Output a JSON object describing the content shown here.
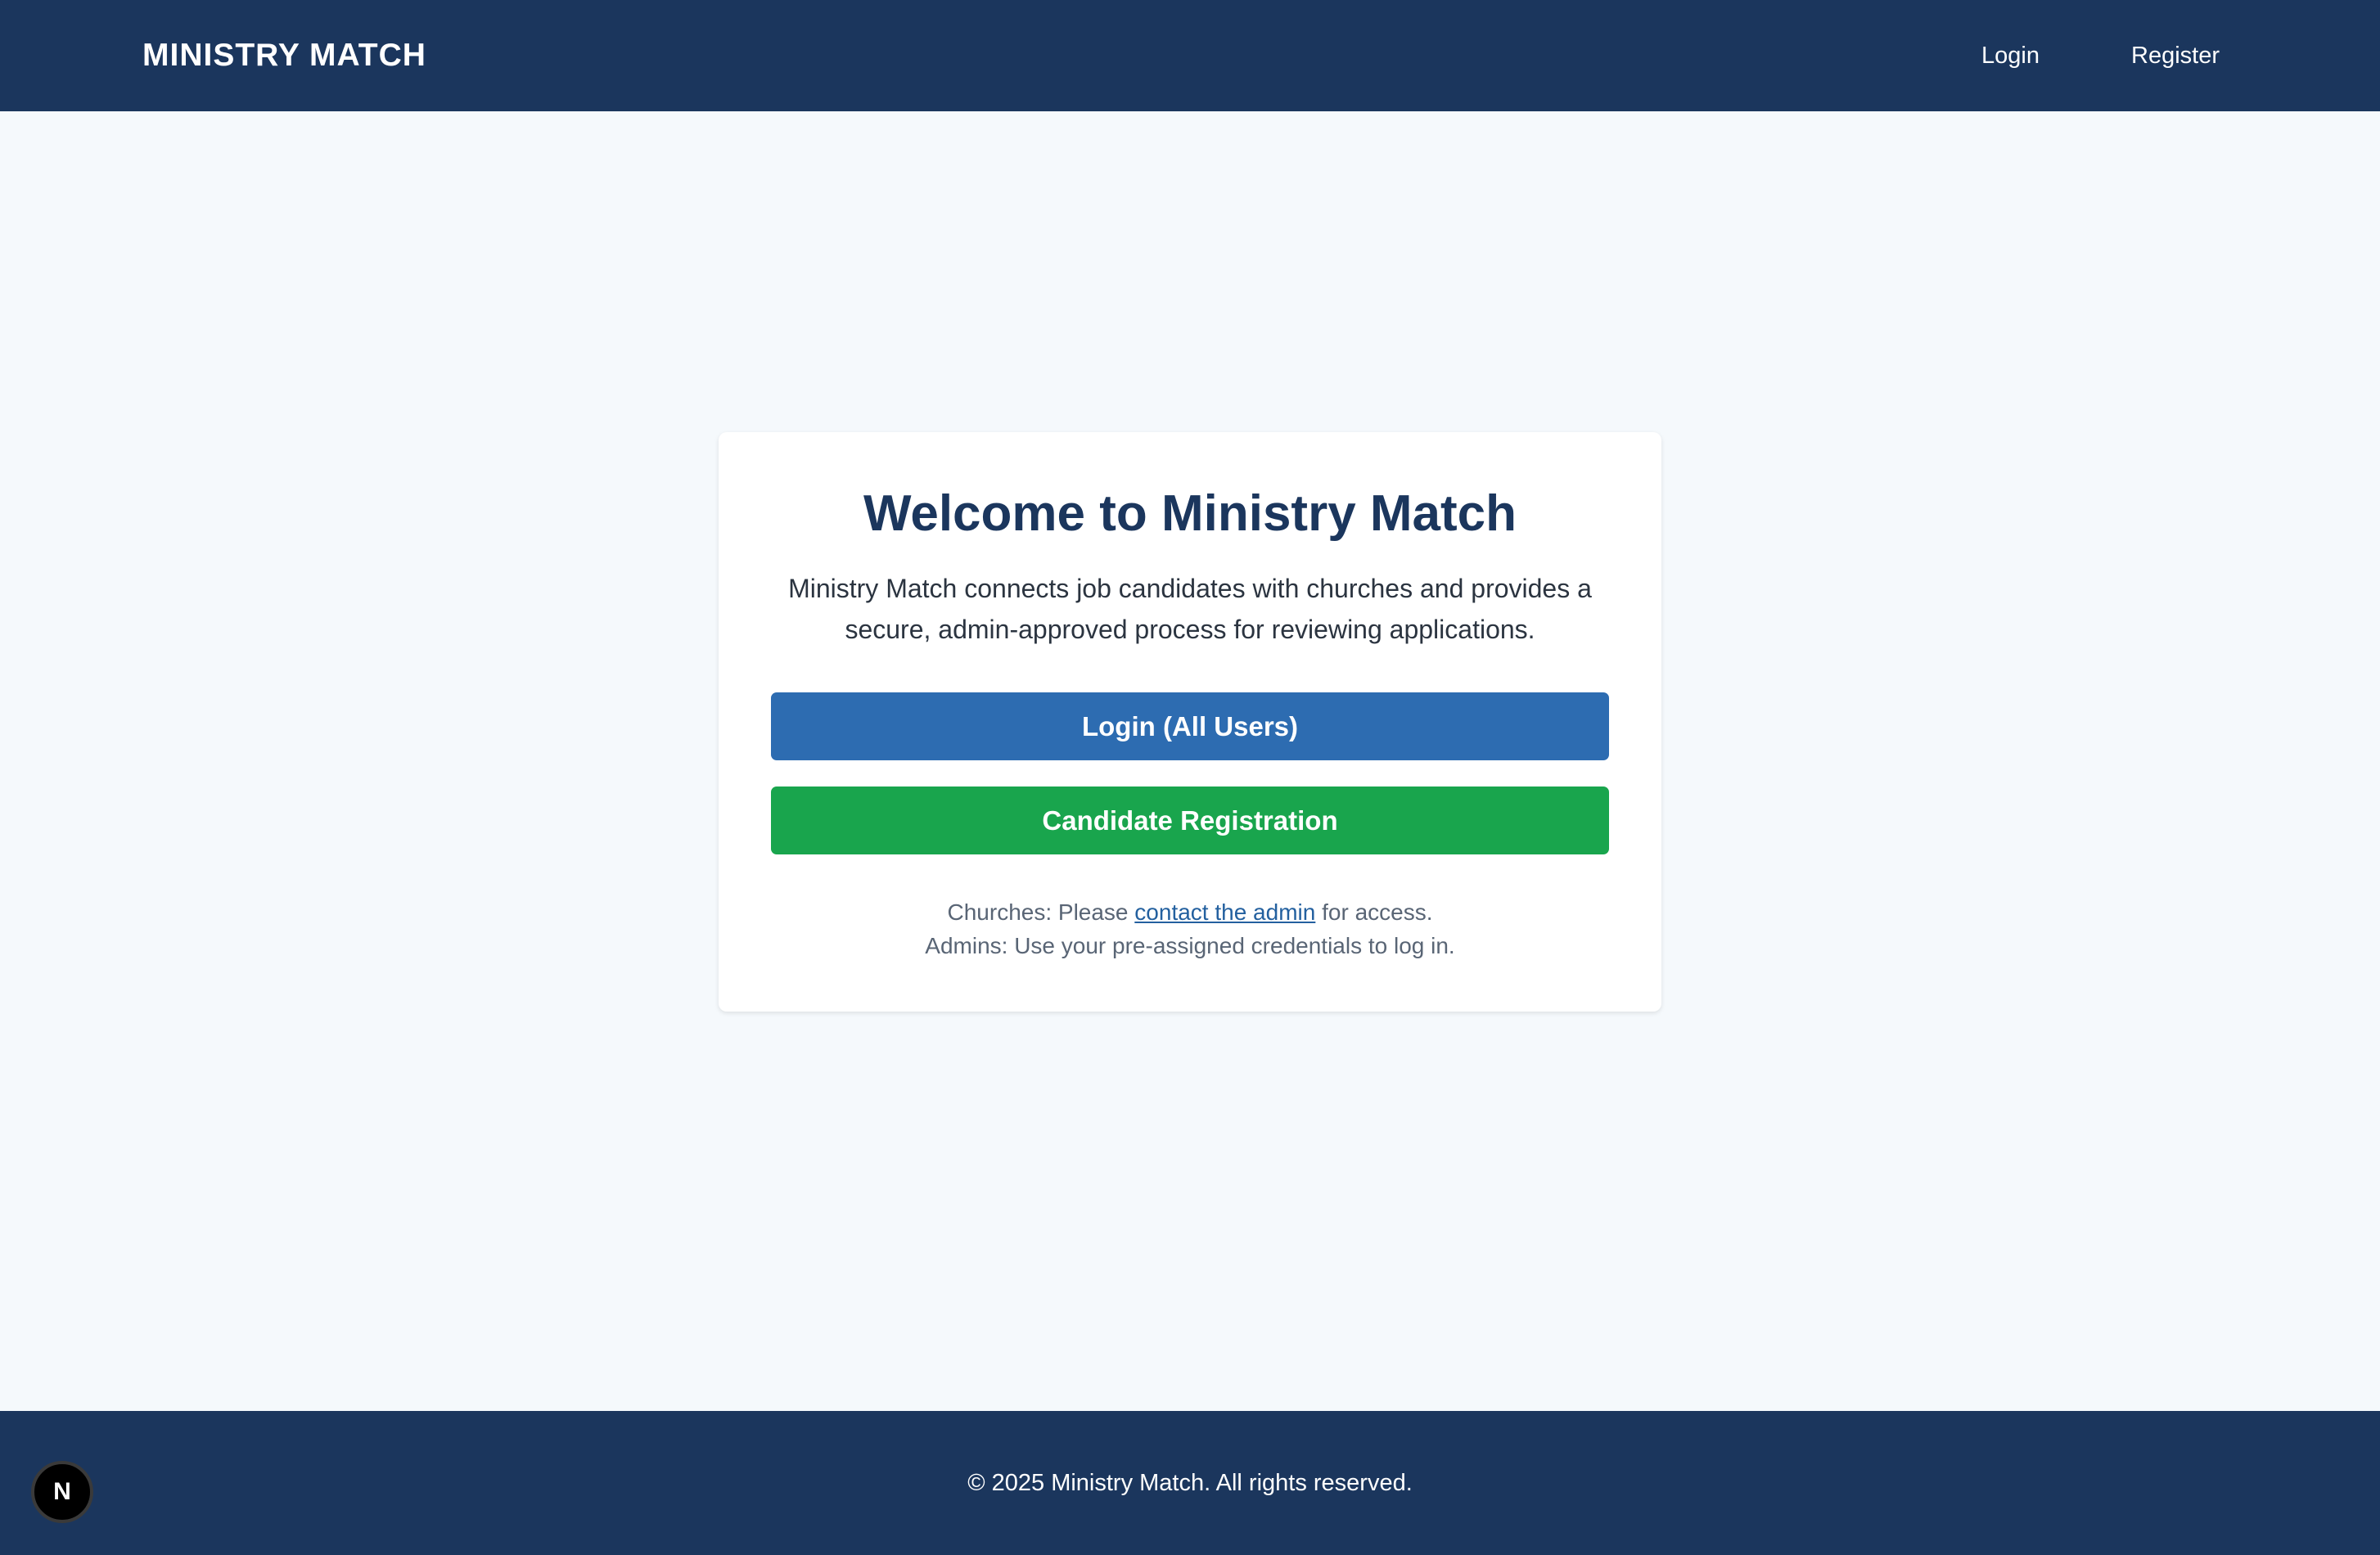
{
  "header": {
    "brand": "MINISTRY MATCH",
    "nav": {
      "login": "Login",
      "register": "Register"
    }
  },
  "welcome": {
    "title": "Welcome to Ministry Match",
    "intro": "Ministry Match connects job candidates with churches and provides a secure, admin-approved process for reviewing applications.",
    "login_button": "Login (All Users)",
    "register_button": "Candidate Registration",
    "churches_prefix": "Churches: Please ",
    "churches_link": "contact the admin",
    "churches_suffix": " for access.",
    "admins_note": "Admins: Use your pre-assigned credentials to log in."
  },
  "footer": {
    "copyright": "© 2025 Ministry Match. All rights reserved."
  },
  "dev_badge": {
    "letter": "N",
    "icon": "nextjs-icon"
  },
  "colors": {
    "header_bg": "#1b365d",
    "page_bg": "#f5f9fc",
    "primary_button": "#2d6cb1",
    "success_button": "#19a54d",
    "title": "#1b365d"
  }
}
